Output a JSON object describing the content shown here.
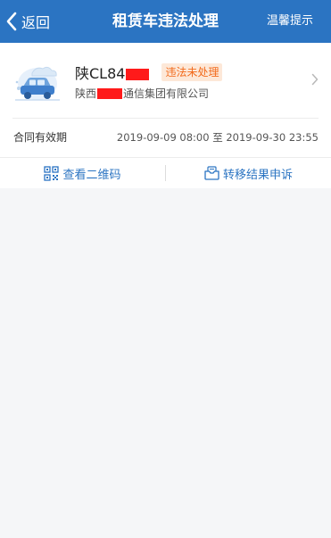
{
  "nav": {
    "back_label": "返回",
    "title": "租赁车违法处理",
    "tip_label": "温馨提示"
  },
  "vehicle": {
    "plate_visible": "陕CL84",
    "status_badge": "违法未处理",
    "company_prefix": "陕西",
    "company_suffix": "通信集团有限公司"
  },
  "contract": {
    "label": "合同有效期",
    "value": "2019-09-09 08:00 至 2019-09-30 23:55"
  },
  "actions": {
    "qr_label": "查看二维码",
    "appeal_label": "转移结果申诉"
  },
  "colors": {
    "nav_bg": "#2b74c2",
    "accent": "#2b74c2",
    "badge_bg": "#fde8d8",
    "badge_text": "#f26a1b",
    "redaction": "#ff1a1a"
  },
  "icons": {
    "back": "chevron-left-icon",
    "car": "car-illustration-icon",
    "chevron": "chevron-right-icon",
    "qr": "qr-code-icon",
    "appeal": "appeal-box-icon"
  }
}
